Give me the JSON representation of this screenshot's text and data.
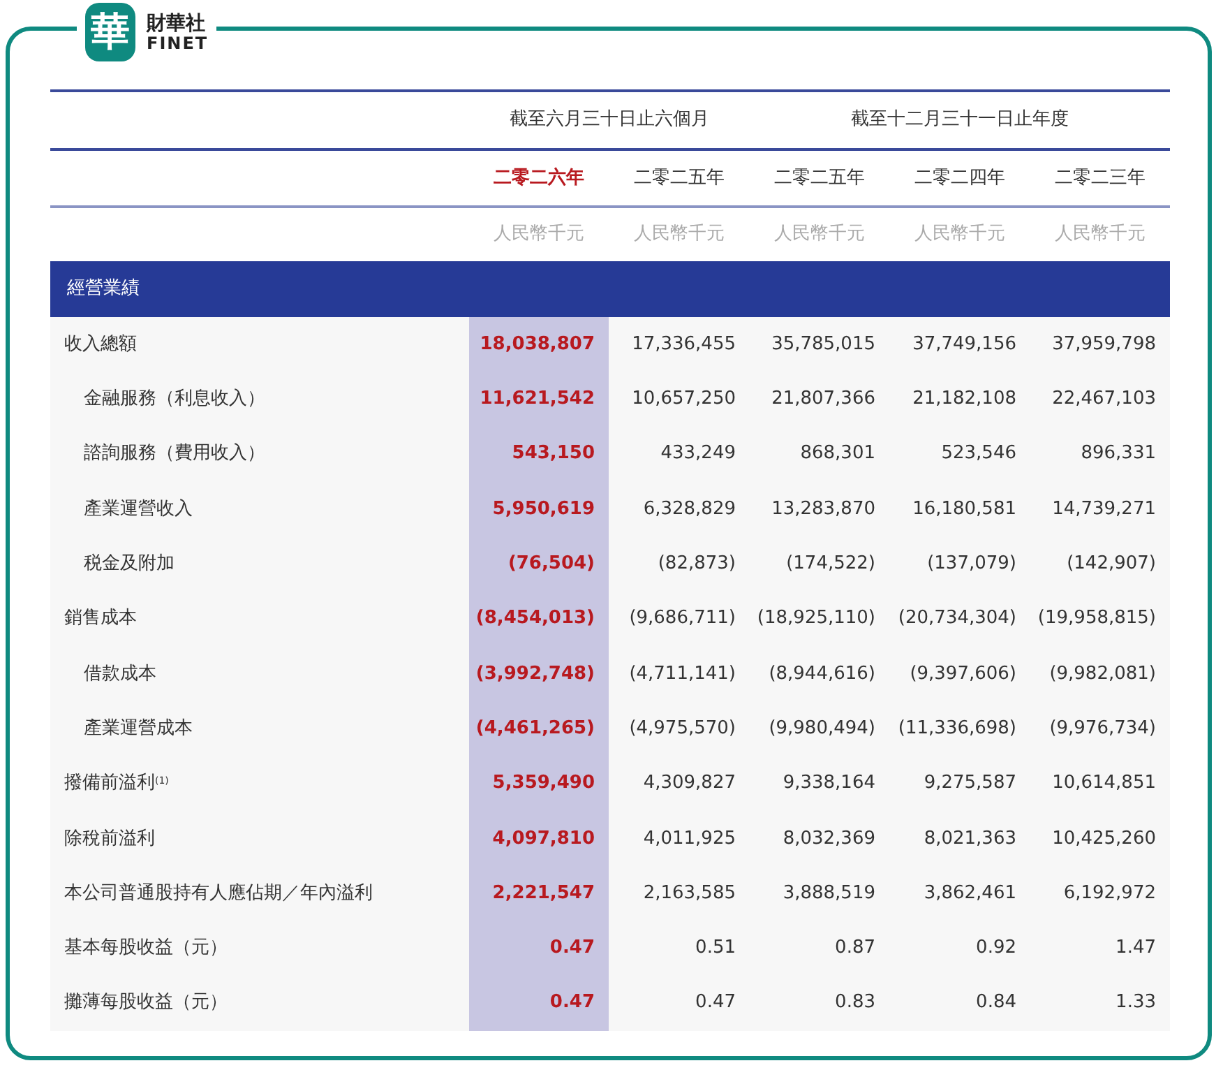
{
  "logo": {
    "mark": "華",
    "name": "財華社",
    "subname": "FINET"
  },
  "table": {
    "column_groups": [
      {
        "label": "截至六月三十日止六個月",
        "columns": [
          {
            "year": "二零二六年",
            "unit": "人民幣千元",
            "selected": true
          },
          {
            "year": "二零二五年",
            "unit": "人民幣千元",
            "selected": false
          }
        ]
      },
      {
        "label": "截至十二月三十一日止年度",
        "columns": [
          {
            "year": "二零二五年",
            "unit": "人民幣千元",
            "selected": false
          },
          {
            "year": "二零二四年",
            "unit": "人民幣千元",
            "selected": false
          },
          {
            "year": "二零二三年",
            "unit": "人民幣千元",
            "selected": false
          }
        ]
      }
    ],
    "section": "經營業績",
    "rows": [
      {
        "label": "收入總額",
        "values": [
          "18,038,807",
          "17,336,455",
          "35,785,015",
          "37,749,156",
          "37,959,798"
        ],
        "children": [
          {
            "label": "金融服務（利息收入）",
            "values": [
              "11,621,542",
              "10,657,250",
              "21,807,366",
              "21,182,108",
              "22,467,103"
            ]
          },
          {
            "label": "諮詢服務（費用收入）",
            "values": [
              "543,150",
              "433,249",
              "868,301",
              "523,546",
              "896,331"
            ]
          },
          {
            "label": "產業運營收入",
            "values": [
              "5,950,619",
              "6,328,829",
              "13,283,870",
              "16,180,581",
              "14,739,271"
            ]
          },
          {
            "label": "税金及附加",
            "values": [
              "(76,504)",
              "(82,873)",
              "(174,522)",
              "(137,079)",
              "(142,907)"
            ]
          }
        ]
      },
      {
        "label": "銷售成本",
        "values": [
          "(8,454,013)",
          "(9,686,711)",
          "(18,925,110)",
          "(20,734,304)",
          "(19,958,815)"
        ],
        "children": [
          {
            "label": "借款成本",
            "values": [
              "(3,992,748)",
              "(4,711,141)",
              "(8,944,616)",
              "(9,397,606)",
              "(9,982,081)"
            ]
          },
          {
            "label": "產業運營成本",
            "values": [
              "(4,461,265)",
              "(4,975,570)",
              "(9,980,494)",
              "(11,336,698)",
              "(9,976,734)"
            ]
          }
        ]
      },
      {
        "label": "撥備前溢利$^{(1)}$",
        "values": [
          "5,359,490",
          "4,309,827",
          "9,338,164",
          "9,275,587",
          "10,614,851"
        ]
      },
      {
        "label": "除稅前溢利",
        "values": [
          "4,097,810",
          "4,011,925",
          "8,032,369",
          "8,021,363",
          "10,425,260"
        ]
      },
      {
        "label": "本公司普通股持有人應佔期／年內溢利",
        "values": [
          "2,221,547",
          "2,163,585",
          "3,888,519",
          "3,862,461",
          "6,192,972"
        ]
      },
      {
        "label": "基本每股收益（元）",
        "values": [
          "0.47",
          "0.51",
          "0.87",
          "0.92",
          "1.47"
        ]
      },
      {
        "label": "攤薄每股收益（元）",
        "values": [
          "0.47",
          "0.47",
          "0.83",
          "0.84",
          "1.33"
        ]
      }
    ]
  }
}
